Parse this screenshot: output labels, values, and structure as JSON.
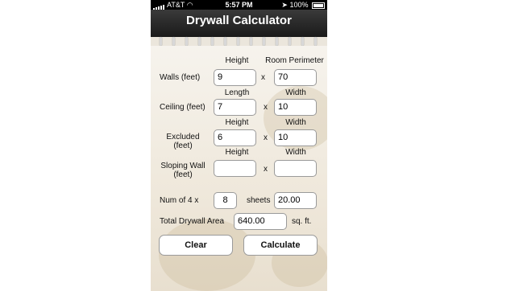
{
  "status_bar": {
    "carrier": "AT&T",
    "time": "5:57 PM",
    "battery": "100%"
  },
  "app": {
    "title": "Drywall Calculator"
  },
  "rows": {
    "walls": {
      "label": "Walls (feet)",
      "header_a": "Height",
      "header_b": "Room Perimeter",
      "value_a": "9",
      "value_b": "70",
      "times": "x"
    },
    "ceiling": {
      "label": "Ceiling (feet)",
      "header_a": "Length",
      "header_b": "Width",
      "value_a": "7",
      "value_b": "10",
      "times": "x"
    },
    "excluded": {
      "label_line1": "Excluded",
      "label_line2": "(feet)",
      "header_a": "Height",
      "header_b": "Width",
      "value_a": "6",
      "value_b": "10",
      "times": "x"
    },
    "sloping": {
      "label_line1": "Sloping Wall",
      "label_line2": "(feet)",
      "header_a": "Height",
      "header_b": "Width",
      "value_a": "",
      "value_b": "",
      "times": "x"
    }
  },
  "sheets": {
    "label": "Num of 4 x",
    "size_value": "8",
    "sheets_label": "sheets",
    "sheets_value": "20.00"
  },
  "total": {
    "label": "Total Drywall Area",
    "value": "640.00",
    "unit": "sq. ft."
  },
  "buttons": {
    "clear": "Clear",
    "calculate": "Calculate"
  }
}
